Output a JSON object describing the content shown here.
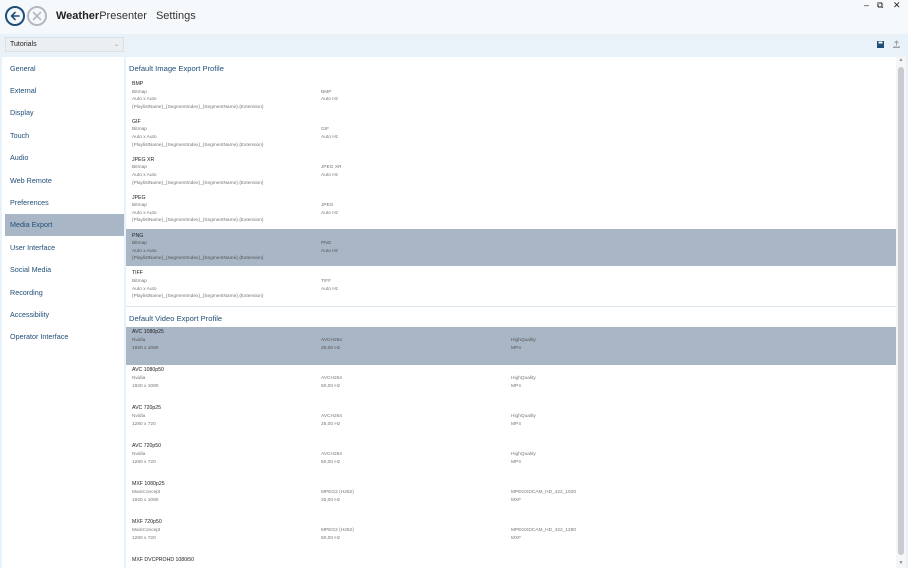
{
  "app": {
    "title_bold": "Weather",
    "title_light": "Presenter",
    "page": "Settings"
  },
  "window": {
    "minimize": "–",
    "restore": "⧉",
    "close": "✕"
  },
  "sidebar": {
    "dropdown": "Tutorials",
    "items": [
      {
        "label": "General"
      },
      {
        "label": "External"
      },
      {
        "label": "Display"
      },
      {
        "label": "Touch"
      },
      {
        "label": "Audio"
      },
      {
        "label": "Web Remote"
      },
      {
        "label": "Preferences"
      },
      {
        "label": "Media Export",
        "active": true
      },
      {
        "label": "User Interface"
      },
      {
        "label": "Social Media"
      },
      {
        "label": "Recording"
      },
      {
        "label": "Accessibility"
      },
      {
        "label": "Operator Interface"
      }
    ]
  },
  "toolbar": {
    "icons": [
      "save-icon",
      "export-icon"
    ]
  },
  "image_section": {
    "title": "Default Image Export Profile",
    "rows": [
      {
        "name": "BMP",
        "l1": "Bitmap",
        "l2": "Auto x Auto",
        "l3": "{PlaylistName}_{SegmentIndex}_{SegmentName}.{Extension}",
        "c2a": "BMP",
        "c2b": "Auto Hz",
        "selected": false
      },
      {
        "name": "GIF",
        "l1": "Bitmap",
        "l2": "Auto x Auto",
        "l3": "{PlaylistName}_{SegmentIndex}_{SegmentName}.{Extension}",
        "c2a": "GIF",
        "c2b": "Auto Hz",
        "selected": false
      },
      {
        "name": "JPEG XR",
        "l1": "Bitmap",
        "l2": "Auto x Auto",
        "l3": "{PlaylistName}_{SegmentIndex}_{SegmentName}.{Extension}",
        "c2a": "JPEG XR",
        "c2b": "Auto Hz",
        "selected": false
      },
      {
        "name": "JPEG",
        "l1": "Bitmap",
        "l2": "Auto x Auto",
        "l3": "{PlaylistName}_{SegmentIndex}_{SegmentName}.{Extension}",
        "c2a": "JPEG",
        "c2b": "Auto Hz",
        "selected": false
      },
      {
        "name": "PNG",
        "l1": "Bitmap",
        "l2": "Auto x Auto",
        "l3": "{PlaylistName}_{SegmentIndex}_{SegmentName}.{Extension}",
        "c2a": "PNG",
        "c2b": "Auto Hz",
        "selected": true
      },
      {
        "name": "TIFF",
        "l1": "Bitmap",
        "l2": "Auto x Auto",
        "l3": "{PlaylistName}_{SegmentIndex}_{SegmentName}.{Extension}",
        "c2a": "TIFF",
        "c2b": "Auto Hz",
        "selected": false
      }
    ]
  },
  "video_section": {
    "title": "Default Video Export Profile",
    "rows": [
      {
        "name": "AVC 1080p25",
        "l1": "Nvidia",
        "l2": "1920 x 1080",
        "c2a": "AVCH264",
        "c2b": "25,00 Hz",
        "c3a": "HighQuality",
        "c3b": "MP4",
        "selected": true
      },
      {
        "name": "AVC 1080p50",
        "l1": "Nvidia",
        "l2": "1920 x 1080",
        "c2a": "AVCH264",
        "c2b": "50,00 Hz",
        "c3a": "HighQuality",
        "c3b": "MP4",
        "selected": false
      },
      {
        "name": "AVC 720p25",
        "l1": "Nvidia",
        "l2": "1280 x 720",
        "c2a": "AVCH264",
        "c2b": "25,00 Hz",
        "c3a": "HighQuality",
        "c3b": "MP4",
        "selected": false
      },
      {
        "name": "AVC 720p50",
        "l1": "Nvidia",
        "l2": "1280 x 720",
        "c2a": "AVCH264",
        "c2b": "50,00 Hz",
        "c3a": "HighQuality",
        "c3b": "MP4",
        "selected": false
      },
      {
        "name": "MXF 1080p25",
        "l1": "MainConcept",
        "l2": "1920 x 1080",
        "c2a": "MPEG2 (H262)",
        "c2b": "25,00 Hz",
        "c3a": "MPEGXDCAM_HD_422_1920",
        "c3b": "MXF",
        "selected": false
      },
      {
        "name": "MXF 720p50",
        "l1": "MainConcept",
        "l2": "1280 x 720",
        "c2a": "MPEG2 (H262)",
        "c2b": "50,00 Hz",
        "c3a": "MPEGXDCAM_HD_422_1280",
        "c3b": "MXF",
        "selected": false
      },
      {
        "name": "MXF DVCPROHD 1080i50",
        "l1": "",
        "l2": "",
        "c2a": "",
        "c2b": "",
        "c3a": "",
        "c3b": "",
        "selected": false
      }
    ]
  },
  "colors": {
    "accent": "#1f4e79",
    "selected_row": "#a9b6c6",
    "background": "#eaf2f9"
  }
}
